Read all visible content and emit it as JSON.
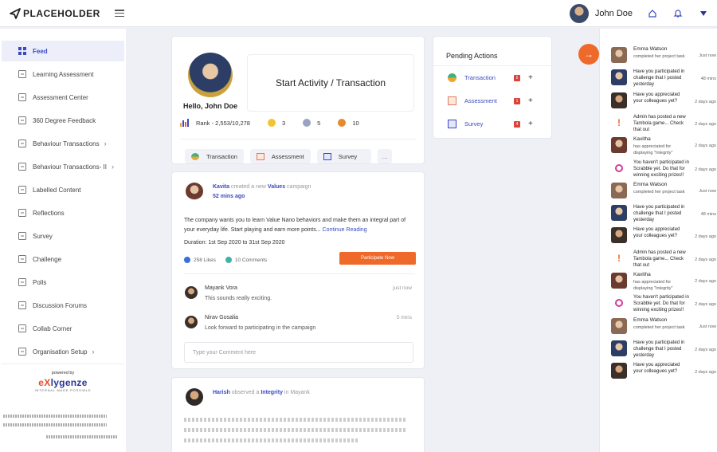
{
  "header": {
    "logo_text": "PLACEHOLDER",
    "user_name": "John Doe"
  },
  "sidebar": {
    "items": [
      {
        "label": "Feed",
        "icon": "feed-icon",
        "active": true,
        "chevron": false
      },
      {
        "label": "Learning Assessment",
        "icon": "book-icon",
        "chevron": false
      },
      {
        "label": "Assessment Center",
        "icon": "checklist-icon",
        "chevron": false
      },
      {
        "label": "360 Degree Feedback",
        "icon": "feedback-icon",
        "chevron": false
      },
      {
        "label": "Behaviour Transactions",
        "icon": "transaction-icon",
        "chevron": true
      },
      {
        "label": "Behaviour Transactions- II",
        "icon": "transaction-icon",
        "chevron": true
      },
      {
        "label": "Labelled Content",
        "icon": "label-icon",
        "chevron": false
      },
      {
        "label": "Reflections",
        "icon": "reflection-icon",
        "chevron": false
      },
      {
        "label": "Survey",
        "icon": "survey-icon",
        "chevron": false
      },
      {
        "label": "Challenge",
        "icon": "challenge-icon",
        "chevron": false
      },
      {
        "label": "Polls",
        "icon": "polls-icon",
        "chevron": false
      },
      {
        "label": "Discussion Forums",
        "icon": "forum-icon",
        "chevron": false
      },
      {
        "label": "Collab Corner",
        "icon": "collab-icon",
        "chevron": false
      },
      {
        "label": "Organisation Setup",
        "icon": "org-icon",
        "chevron": true
      }
    ],
    "powered_by": "powered by",
    "brand_x": "eX",
    "brand_rest": "lygenze",
    "brand_tag": "INTERNAL MADE POSSIBLE"
  },
  "profile": {
    "hello": "Hello, John Doe",
    "start_activity": "Start Activity / Transaction",
    "rank": "Rank - 2,553/10,278",
    "stat_gold": "3",
    "stat_silver": "5",
    "stat_bronze": "10",
    "quick": [
      "Transaction",
      "Assessment",
      "Survey"
    ],
    "more": "..."
  },
  "pending": {
    "title": "Pending Actions",
    "rows": [
      {
        "label": "Transaction",
        "count": "5"
      },
      {
        "label": "Assessment",
        "count": "1"
      },
      {
        "label": "Survey",
        "count": "4"
      }
    ]
  },
  "post1": {
    "author": "Kavita",
    "action": "created a new",
    "target": "Values",
    "suffix": "campaign",
    "time": "52 mins ago",
    "body": "The company wants you to learn Value Nano behaviors and make them an integral part of your everyday life. Start playing and earn more points...",
    "read_more": "Continue Reading",
    "duration": "Duration: 1st Sep 2020 to 31st Sep 2020",
    "likes": "258 Likes",
    "comments_count": "10 Comments",
    "participate": "Participate Now",
    "comments": [
      {
        "name": "Mayank Vora",
        "text": "This sounds really exciting.",
        "time": "just now"
      },
      {
        "name": "Nirav Gosalia",
        "text": "Look forward to participating in the campaign",
        "time": "5 mins"
      }
    ],
    "comment_placeholder": "Type your Comment here"
  },
  "post2": {
    "author": "Harish",
    "action": "observed a",
    "target": "Integrity",
    "suffix": "in Mayank"
  },
  "notifications": [
    {
      "title": "Emma Watson",
      "sub": "completed her project task",
      "time": "Just now",
      "kind": "person"
    },
    {
      "title": "Have you participated in challenge that I posted yesterday",
      "sub": "",
      "time": "48 mins",
      "kind": "person2"
    },
    {
      "title": "Have you appreciated your colleagues yet?",
      "sub": "",
      "time": "2 days ago",
      "kind": "person3"
    },
    {
      "title": "Admin has posted a new Tambola game... Check that out",
      "sub": "",
      "time": "2 days ago",
      "kind": "alert"
    },
    {
      "title": "Kavitha",
      "sub": "has appreciated for displaying \"Integrity\"",
      "time": "2 days ago",
      "kind": "person4"
    },
    {
      "title": "You haven't participated in Scrabble yet. Do that for winning exciting prizes!!",
      "sub": "",
      "time": "2 days ago",
      "kind": "ring"
    },
    {
      "title": "Emma Watson",
      "sub": "completed her project task",
      "time": "Just now",
      "kind": "person"
    },
    {
      "title": "Have you participated in challenge that I posted yesterday",
      "sub": "",
      "time": "48 mins",
      "kind": "person2"
    },
    {
      "title": "Have you appreciated your colleagues yet?",
      "sub": "",
      "time": "2 days ago",
      "kind": "person3"
    },
    {
      "title": "Admin has posted a new Tambola game... Check that out",
      "sub": "",
      "time": "2 days ago",
      "kind": "alert"
    },
    {
      "title": "Kavitha",
      "sub": "has appreciated for displaying \"Integrity\"",
      "time": "2 days ago",
      "kind": "person4"
    },
    {
      "title": "You haven't participated in Scrabble yet. Do that for winning exciting prizes!!",
      "sub": "",
      "time": "2 days ago",
      "kind": "ring"
    },
    {
      "title": "Emma Watson",
      "sub": "completed her project task",
      "time": "Just now",
      "kind": "person"
    },
    {
      "title": "Have you participated in challenge that I posted yesterday",
      "sub": "",
      "time": "2 days ago",
      "kind": "person2"
    },
    {
      "title": "Have you appreciated your colleagues yet?",
      "sub": "",
      "time": "2 days ago",
      "kind": "person3"
    }
  ]
}
